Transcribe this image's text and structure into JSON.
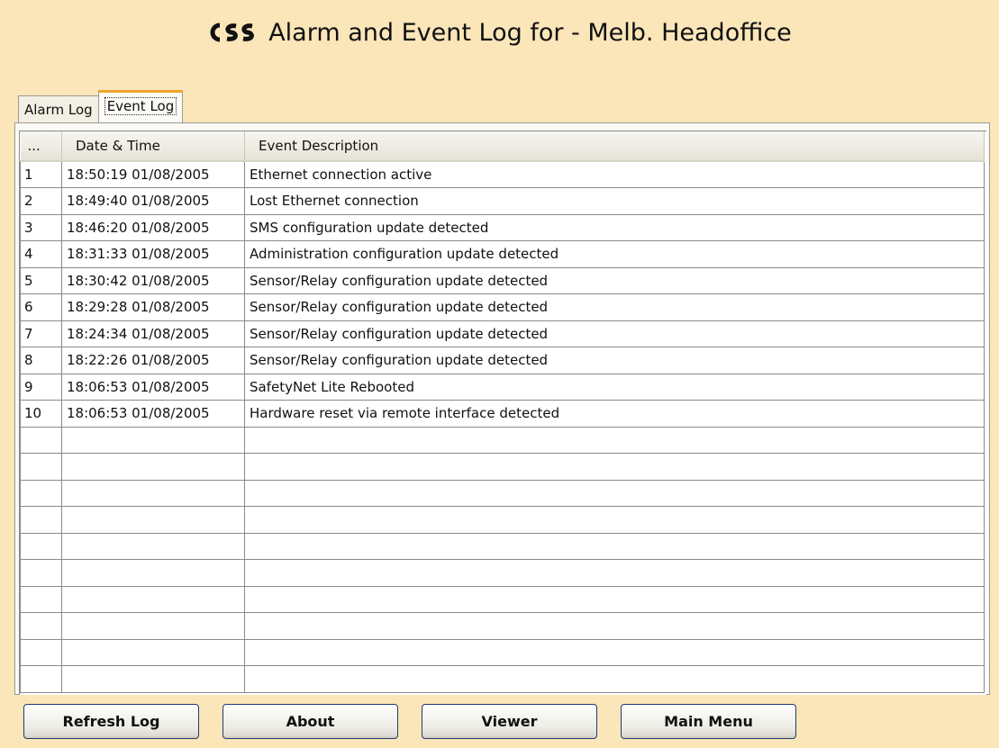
{
  "header": {
    "logo_text": "CSS",
    "title": "Alarm and Event Log for - Melb. Headoffice"
  },
  "tabs": [
    {
      "label": "Alarm Log",
      "active": false
    },
    {
      "label": "Event Log",
      "active": true
    }
  ],
  "table": {
    "columns": [
      "...",
      "Date & Time",
      "Event Description"
    ],
    "rows": [
      [
        "1",
        "18:50:19 01/08/2005",
        "Ethernet connection active"
      ],
      [
        "2",
        "18:49:40 01/08/2005",
        "Lost Ethernet connection"
      ],
      [
        "3",
        "18:46:20 01/08/2005",
        "SMS configuration update detected"
      ],
      [
        "4",
        "18:31:33 01/08/2005",
        "Administration configuration update detected"
      ],
      [
        "5",
        "18:30:42 01/08/2005",
        "Sensor/Relay configuration update detected"
      ],
      [
        "6",
        "18:29:28 01/08/2005",
        "Sensor/Relay configuration update detected"
      ],
      [
        "7",
        "18:24:34 01/08/2005",
        "Sensor/Relay configuration update detected"
      ],
      [
        "8",
        "18:22:26 01/08/2005",
        "Sensor/Relay configuration update detected"
      ],
      [
        "9",
        "18:06:53 01/08/2005",
        "SafetyNet Lite Rebooted"
      ],
      [
        "10",
        "18:06:53 01/08/2005",
        "Hardware reset via remote interface detected"
      ]
    ]
  },
  "buttons": {
    "refresh": "Refresh Log",
    "about": "About",
    "viewer": "Viewer",
    "main_menu": "Main Menu"
  },
  "colors": {
    "background": "#fbe6b9",
    "tab_highlight": "#f0a42b",
    "button_border": "#1f3a74"
  }
}
